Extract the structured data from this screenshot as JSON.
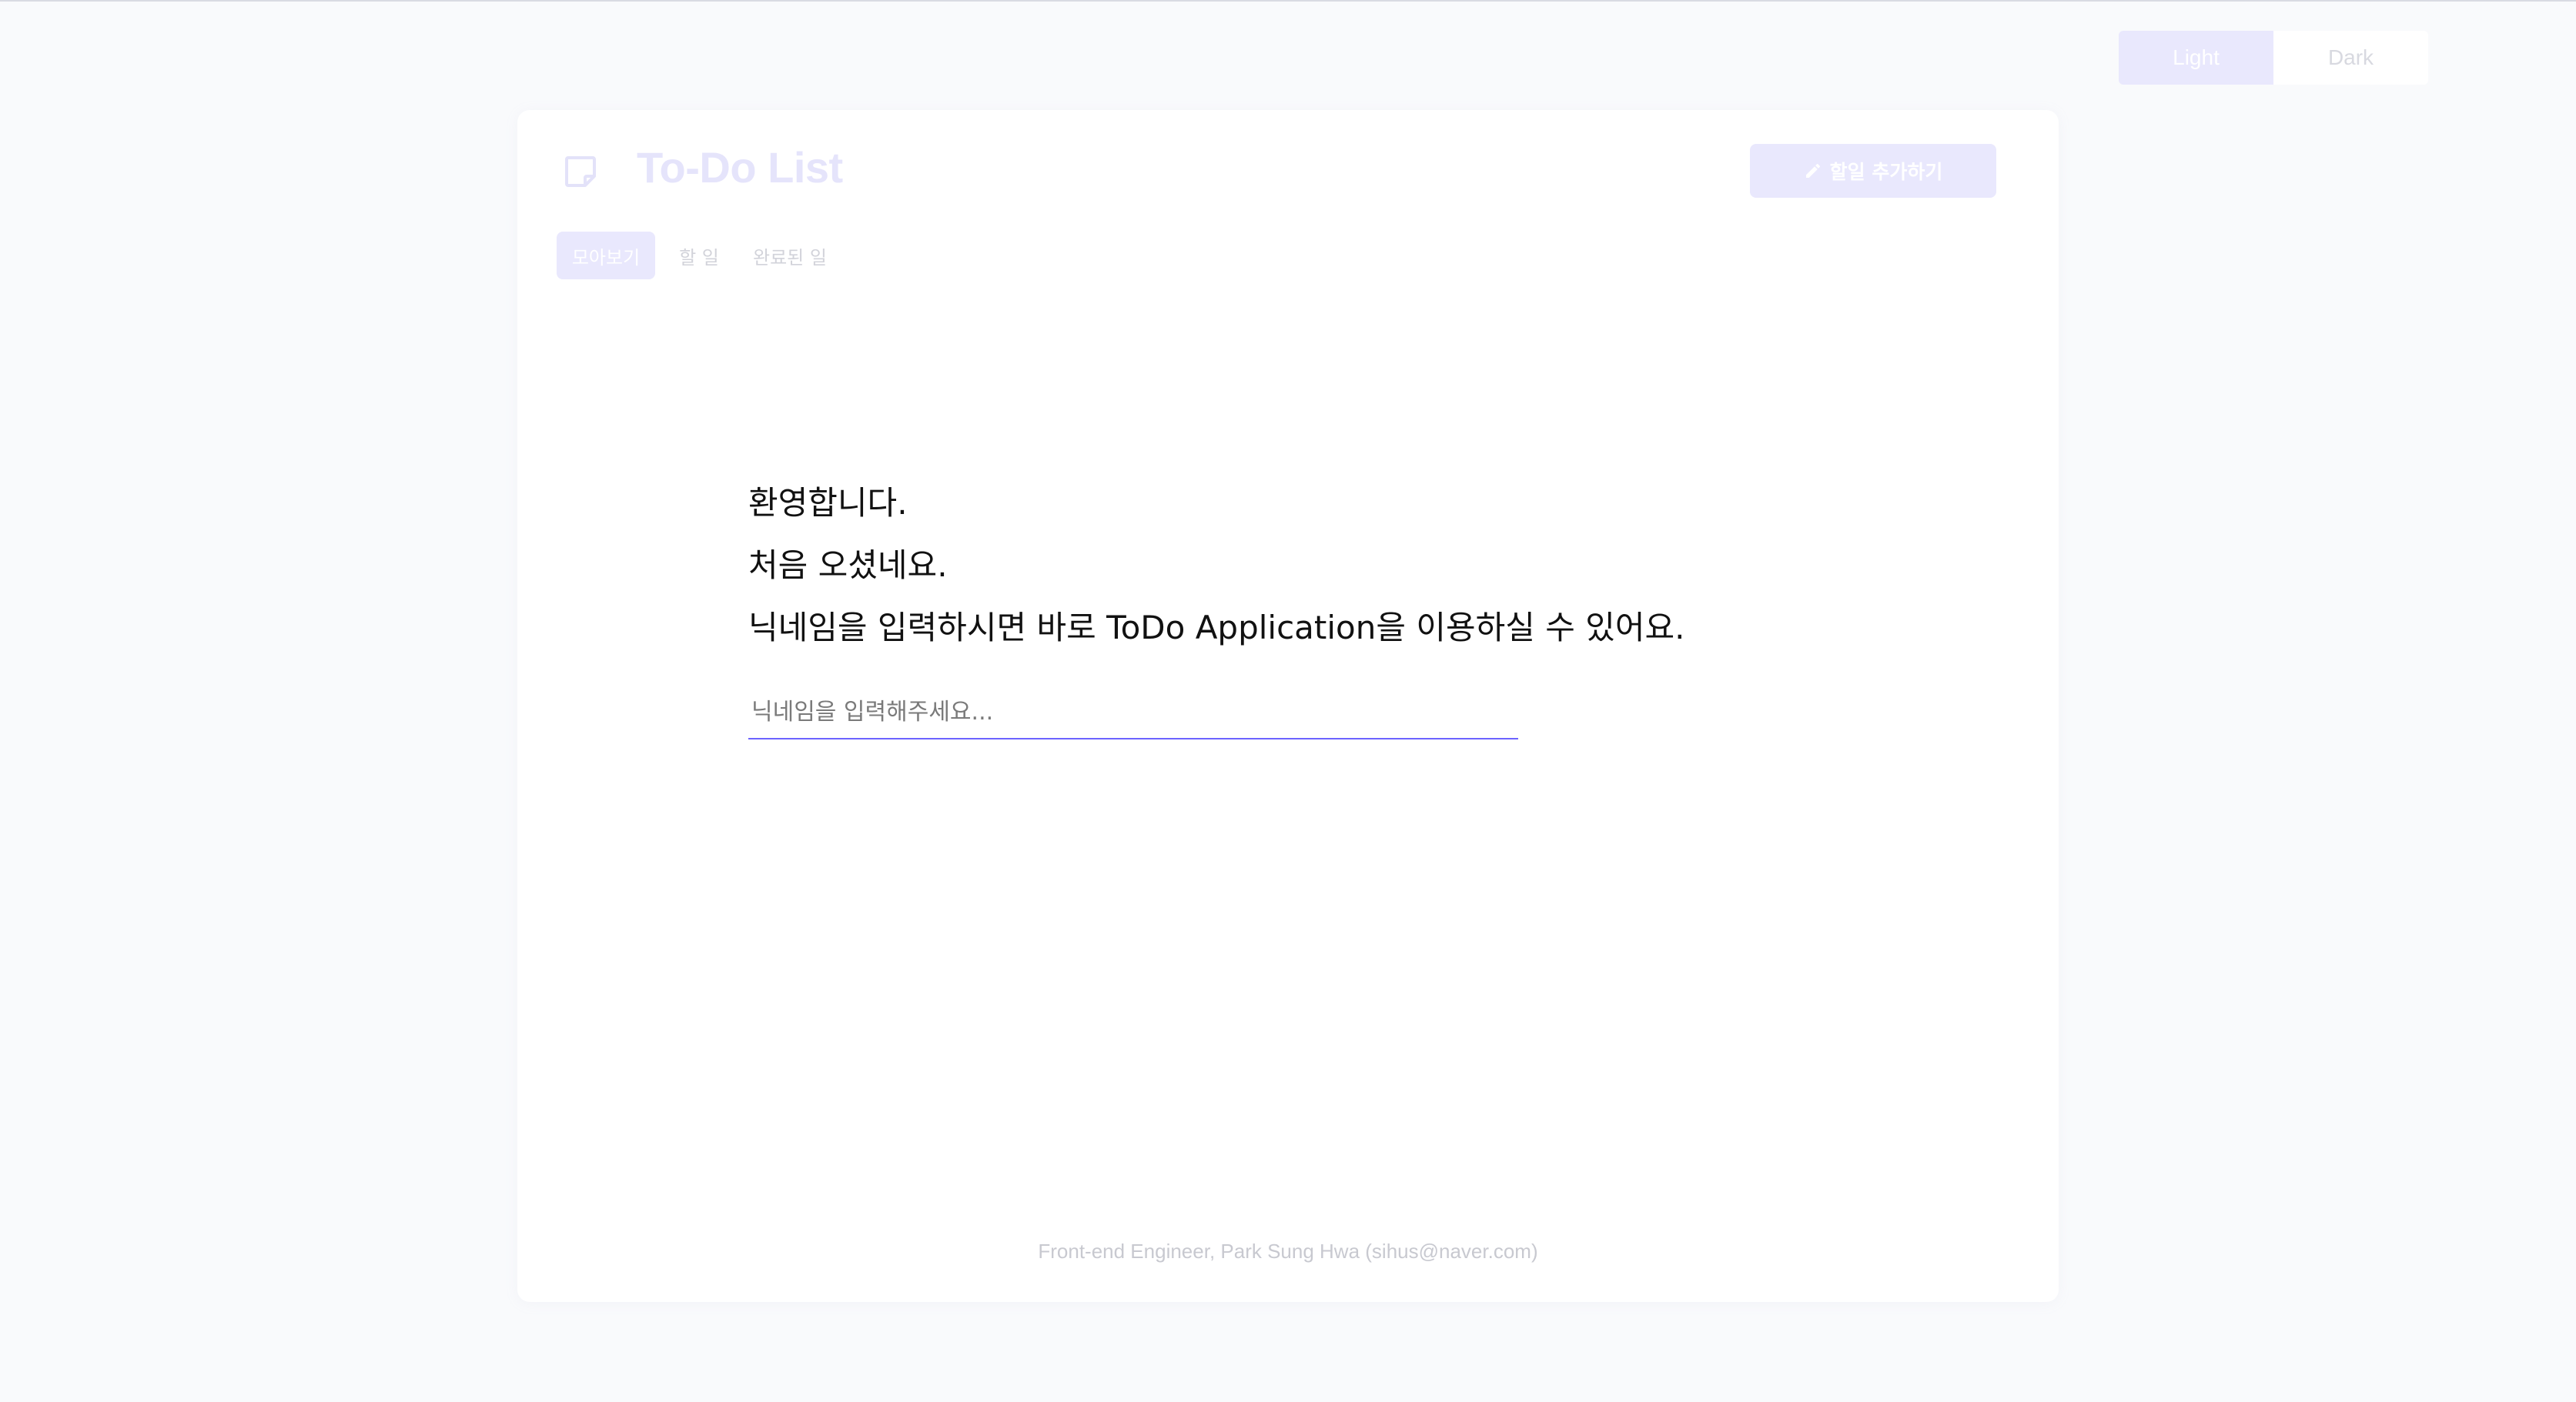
{
  "theme_toggle": {
    "options": [
      "Light",
      "Dark"
    ],
    "selected": "Light"
  },
  "header": {
    "title": "To-Do List",
    "icon": "sticky-note-icon",
    "add_button_label": "할일 추가하기",
    "add_button_icon": "pencil-icon"
  },
  "tabs": [
    {
      "label": "모아보기",
      "active": true
    },
    {
      "label": "할 일",
      "active": false
    },
    {
      "label": "완료된 일",
      "active": false
    }
  ],
  "welcome": {
    "line1": "환영합니다.",
    "line2": "처음 오셨네요.",
    "line3": "닉네임을 입력하시면 바로 ToDo Application을 이용하실 수 있어요."
  },
  "nickname_input": {
    "value": "",
    "placeholder": "닉네임을 입력해주세요..."
  },
  "footer": {
    "text": "Front-end Engineer, Park Sung Hwa (sihus@naver.com)"
  },
  "colors": {
    "accent": "#6c63ff",
    "accent_light": "#e9e8fd",
    "background": "#f9fafc",
    "card": "#ffffff"
  }
}
